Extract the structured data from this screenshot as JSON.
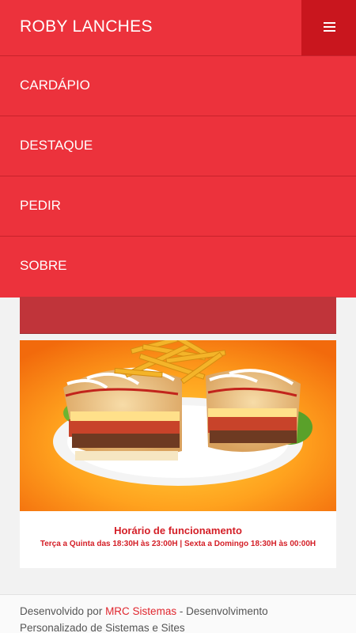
{
  "header": {
    "brand": "ROBY LANCHES",
    "menu_icon": "hamburger-menu-icon"
  },
  "nav": {
    "items": [
      {
        "label": "CARDÁPIO"
      },
      {
        "label": "DESTAQUE"
      },
      {
        "label": "PEDIR"
      },
      {
        "label": "SOBRE"
      }
    ]
  },
  "hours": {
    "title": "Horário de funcionamento",
    "text": "Terça a Quinta das 18:30H às 23:00H | Sexta a Domingo 18:30H às 00:00H"
  },
  "footer": {
    "prefix": "Desenvolvido por ",
    "link_label": "MRC Sistemas",
    "suffix": " - Desenvolvimento Personalizado de Sistemas e Sites"
  },
  "colors": {
    "primary_red": "#ec323c",
    "dark_red": "#c9161e",
    "text_red": "#d41f27"
  }
}
